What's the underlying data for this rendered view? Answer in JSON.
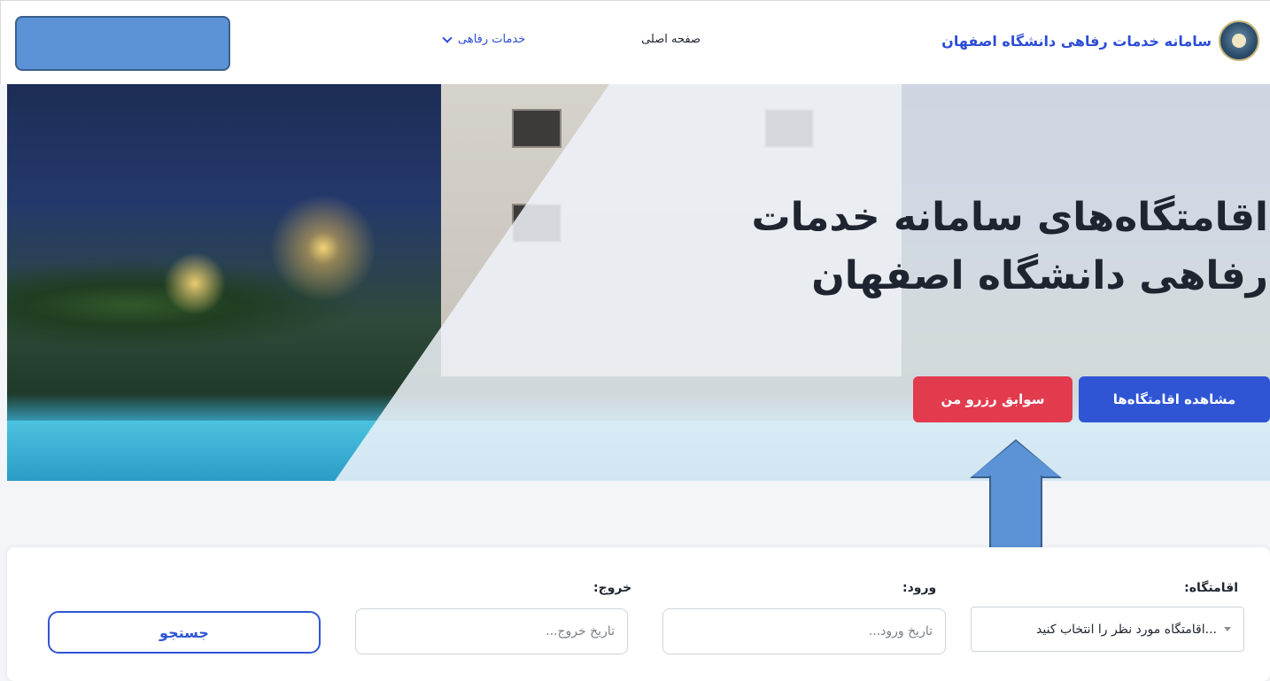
{
  "header": {
    "brand_title": "سامانه خدمات رفاهی دانشگاه اصفهان",
    "nav": {
      "home": "صفحه اصلی",
      "services": "خدمات رفاهی"
    }
  },
  "hero": {
    "title_line1": "اقامتگاه‌های سامانه خدمات",
    "title_line2": "رفاهی دانشگاه اصفهان",
    "view_button": "مشاهده اقامتگاه‌ها",
    "history_button": "سوابق رزرو من"
  },
  "search": {
    "lodging_label": "اقامتگاه:",
    "lodging_value": "...اقامتگاه مورد نظر را انتخاب کنید",
    "checkin_label": "ورود:",
    "checkin_placeholder": "تاریخ ورود...",
    "checkout_label": "خروج:",
    "checkout_placeholder": "تاریخ خروج...",
    "search_button": "جستجو"
  },
  "colors": {
    "primary": "#2f55d4",
    "danger": "#e23b4e",
    "annotation": "#5b93d6"
  }
}
